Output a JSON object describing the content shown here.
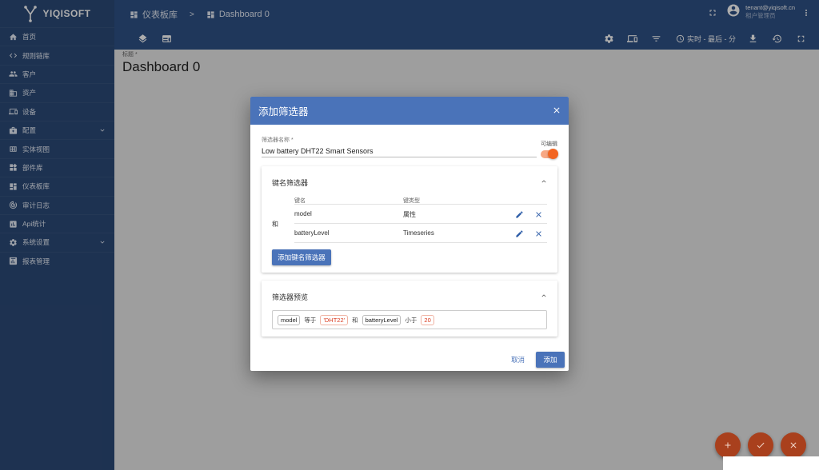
{
  "app": {
    "logo_text": "YIQISOFT"
  },
  "sidebar": {
    "items": [
      {
        "label": "首页",
        "icon": "home-icon"
      },
      {
        "label": "规则链库",
        "icon": "code-arrows-icon"
      },
      {
        "label": "客户",
        "icon": "people-icon"
      },
      {
        "label": "资产",
        "icon": "domain-icon"
      },
      {
        "label": "设备",
        "icon": "devices-icon"
      },
      {
        "label": "配置",
        "icon": "settings-box-icon",
        "expandable": true
      },
      {
        "label": "实体视图",
        "icon": "view-quilt-icon"
      },
      {
        "label": "部件库",
        "icon": "widgets-icon"
      },
      {
        "label": "仪表板库",
        "icon": "dashboard-icon"
      },
      {
        "label": "审计日志",
        "icon": "track-changes-icon"
      },
      {
        "label": "Api统计",
        "icon": "chart-icon"
      },
      {
        "label": "系统设置",
        "icon": "gear-icon",
        "expandable": true
      },
      {
        "label": "报表管理",
        "icon": "report-icon"
      }
    ]
  },
  "header": {
    "breadcrumb": [
      {
        "label": "仪表板库"
      },
      {
        "label": "Dashboard 0"
      }
    ],
    "breadcrumb_separator": ">",
    "user_email": "tenant@yiqisoft.cn",
    "user_role": "租户管理员"
  },
  "toolbar": {
    "timewindow_label": "实时 - 最后 - 分"
  },
  "dashboard": {
    "title_label": "标题 *",
    "title_value": "Dashboard 0"
  },
  "dialog": {
    "title": "添加筛选器",
    "filter_name_label": "筛选器名称 *",
    "filter_name_value": "Low battery DHT22 Smart Sensors",
    "editable_label": "可编辑",
    "editable_on": true,
    "key_filters": {
      "title": "键名筛选器",
      "col_key": "键名",
      "col_type": "键类型",
      "logic_label": "和",
      "rows": [
        {
          "key": "model",
          "type": "属性"
        },
        {
          "key": "batteryLevel",
          "type": "Timeseries"
        }
      ],
      "add_button": "添加键名筛选器"
    },
    "preview": {
      "title": "筛选器预览",
      "parts": [
        {
          "kind": "key",
          "text": "model"
        },
        {
          "kind": "op",
          "text": "等于"
        },
        {
          "kind": "value",
          "text": "'DHT22'"
        },
        {
          "kind": "op",
          "text": "和"
        },
        {
          "kind": "key",
          "text": "batteryLevel"
        },
        {
          "kind": "op",
          "text": "小于"
        },
        {
          "kind": "value",
          "text": "20"
        }
      ]
    },
    "cancel_button": "取消",
    "add_button": "添加"
  },
  "colors": {
    "sidebar": "#2c4a78",
    "header": "#2f5187",
    "dialog_header": "#4a73b9",
    "accent": "#f26522",
    "fab": "#a9401d"
  }
}
